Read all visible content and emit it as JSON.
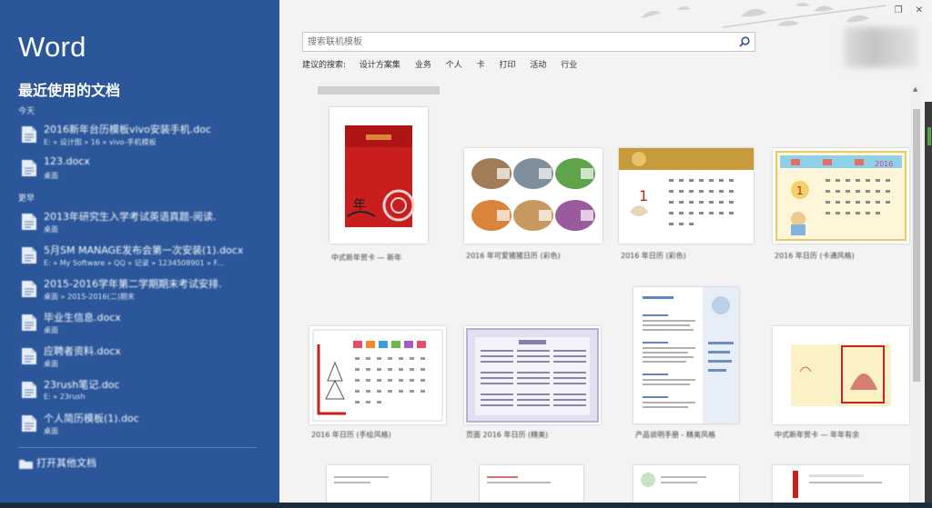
{
  "app": {
    "title": "Word"
  },
  "recent": {
    "heading": "最近使用的文档",
    "groups": [
      {
        "label": "今天",
        "docs": [
          {
            "name": "2016新年台历模板vivo安装手机.doc",
            "path": "E: » 设计图 » 16 » vivo-手机模板"
          },
          {
            "name": "123.docx",
            "path": "桌面"
          }
        ]
      },
      {
        "label": "更早",
        "docs": [
          {
            "name": "2013年研究生入学考试英语真题-阅读.",
            "path": "桌面"
          },
          {
            "name": "5月SM MANAGE发布会第一次安装(1).docx",
            "path": "E: » My Software » QQ » 记录 » 1234508901 » F..."
          },
          {
            "name": "2015-2016学年第二学期期末考试安排.",
            "path": "桌面 » 2015-2016(二)期末"
          },
          {
            "name": "毕业生信息.docx",
            "path": "桌面"
          },
          {
            "name": "应聘者资料.docx",
            "path": "桌面"
          },
          {
            "name": "23rush笔记.doc",
            "path": "E: » 23rush"
          },
          {
            "name": "个人简历模板(1).doc",
            "path": "桌面"
          }
        ]
      }
    ],
    "open_other": "打开其他文档"
  },
  "window": {
    "restore_icon": "restore-icon",
    "close_icon": "close-icon"
  },
  "search": {
    "placeholder": "搜索联机模板",
    "value": ""
  },
  "suggested": {
    "label": "建议的搜索:",
    "links": [
      "设计方案集",
      "业务",
      "个人",
      "卡",
      "打印",
      "活动",
      "行业"
    ]
  },
  "templates": [
    {
      "label": "中式新年贺卡 — 新年",
      "kind": "red-card"
    },
    {
      "label": "2016 年可爱猪猪日历 (彩色)",
      "kind": "pig-calendar"
    },
    {
      "label": "2016 年日历 (彩色)",
      "kind": "gold-calendar"
    },
    {
      "label": "2016 年日历 (卡通风格)",
      "kind": "cartoon-calendar"
    },
    {
      "label": "2016 年日历 (手绘风格)",
      "kind": "sketch-calendar"
    },
    {
      "label": "页面 2016 年日历 (精美)",
      "kind": "lavender-calendar"
    },
    {
      "label": "产品说明手册 - 精美风格",
      "kind": "brochure"
    },
    {
      "label": "中式新年贺卡 — 年年有余",
      "kind": "yellow-card"
    },
    {
      "label": "",
      "kind": "partial"
    },
    {
      "label": "",
      "kind": "partial"
    },
    {
      "label": "",
      "kind": "partial"
    },
    {
      "label": "",
      "kind": "partial"
    }
  ],
  "colors": {
    "word_blue": "#2b579a",
    "card_red": "#c81e1e",
    "background": "#f3f3f3"
  }
}
